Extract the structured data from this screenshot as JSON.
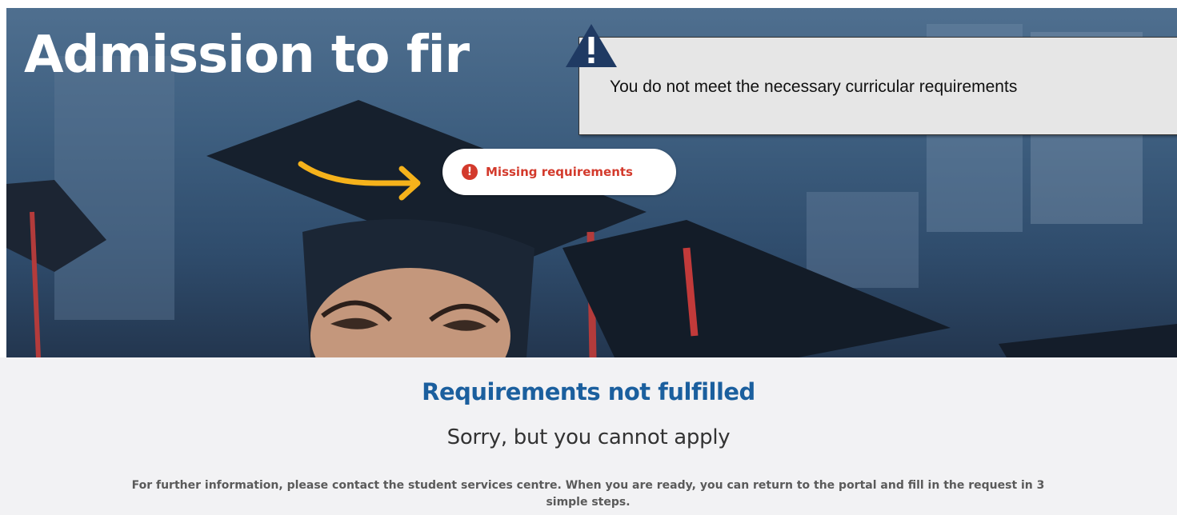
{
  "hero": {
    "title": "Admission to fir",
    "badge": {
      "icon": "exclamation-circle-icon",
      "label": "Missing requirements"
    },
    "arrow_color": "#f5b21b"
  },
  "tooltip": {
    "icon": "warning-triangle-icon",
    "text": "You do not meet the necessary curricular requirements"
  },
  "content": {
    "title": "Requirements not fulfilled",
    "subtitle": "Sorry, but you cannot apply",
    "body": "For further information, please contact the student services centre. When you are ready, you can return to the portal and fill in the request in 3 simple steps."
  },
  "colors": {
    "accent_blue": "#1b5f9e",
    "error_red": "#d33a2c",
    "warning_navy": "#1f3a63"
  }
}
